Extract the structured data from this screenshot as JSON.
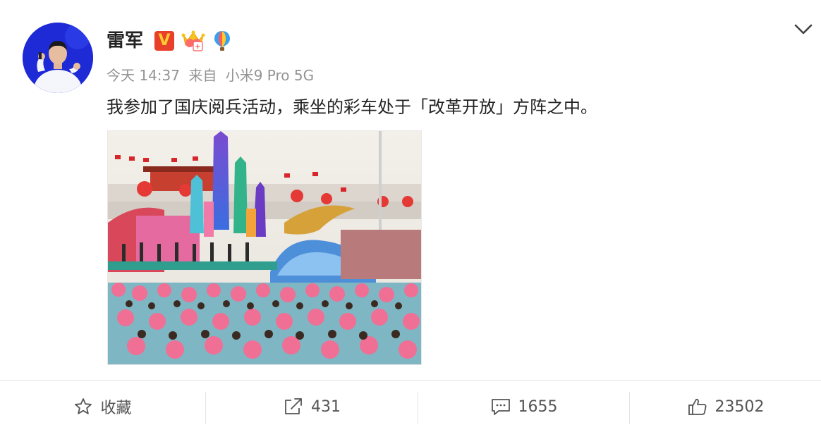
{
  "post": {
    "author": "雷军",
    "verified_badge": "V",
    "time": "今天 14:37",
    "source_prefix": "来自",
    "source_device": "小米9 Pro 5G",
    "text": "我参加了国庆阅兵活动，乘坐的彩车处于「改革开放」方阵之中。",
    "image_icon": "parade-float-photo"
  },
  "actions": {
    "favorite_label": "收藏",
    "repost_count": "431",
    "comment_count": "1655",
    "like_count": "23502"
  },
  "icons": {
    "more": "chevron-down-icon",
    "favorite": "star-outline-icon",
    "repost": "share-arrow-icon",
    "comment": "comment-bubble-icon",
    "like": "thumbs-up-icon"
  },
  "colors": {
    "verified_bg": "#e8402a",
    "verified_text": "#ffcb2f",
    "meta_gray": "#939393",
    "divider": "#e4e4e4"
  }
}
